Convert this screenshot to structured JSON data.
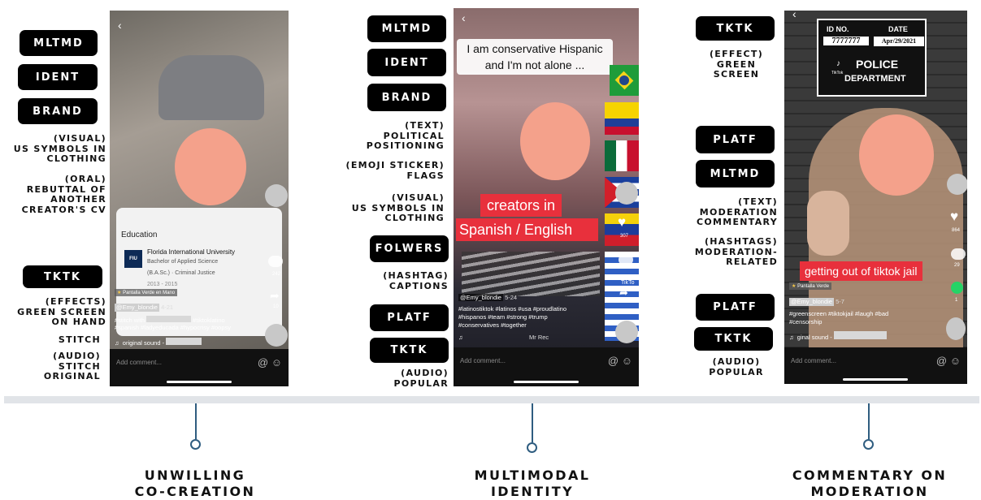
{
  "col1": {
    "pills": [
      "MLTMD",
      "IDENT",
      "BRAND",
      "TKTK"
    ],
    "notes": [
      "(VISUAL)\nUS SYMBOLS IN\nCLOTHING",
      "(ORAL)\nREBUTTAL OF\nANOTHER\nCREATOR'S CV",
      "(EFFECTS)\nGREEN SCREEN\nON HAND",
      "STITCH",
      "(AUDIO)\nSTITCH\nORIGINAL"
    ]
  },
  "col2": {
    "pills": [
      "MLTMD",
      "IDENT",
      "BRAND",
      "FOLWERS",
      "PLATF",
      "TKTK"
    ],
    "notes": [
      "(TEXT)\nPOLITICAL\nPOSITIONING",
      "(EMOJI STICKER)\nFLAGS",
      "(VISUAL)\nUS SYMBOLS IN\nCLOTHING",
      "(HASHTAG)\nCAPTIONS",
      "(AUDIO)\nPOPULAR"
    ]
  },
  "col3": {
    "pills": [
      "TKTK",
      "PLATF",
      "MLTMD",
      "PLATF",
      "TKTK"
    ],
    "notes": [
      "(EFFECT)\nGREEN\nSCREEN",
      "(TEXT)\nMODERATION\nCOMMENTARY",
      "(HASHTAGS)\nMODERATION-\nRELATED",
      "(AUDIO)\nPOPULAR"
    ]
  },
  "phone1": {
    "card_title": "Education",
    "school": "Florida International University",
    "degree": "Bachelor of Applied Science",
    "major": "(B.A.Sc.) · Criminal Justice",
    "years": "2013 - 2015",
    "logo": "FIU",
    "effect": "Pantalla Verde en Mano",
    "user": "@Emy_blondie",
    "date": "4-21",
    "stitch": "#stitch with",
    "tag1": "#tiktoklatino",
    "tags": "#spanish #ladyeducada #hypocrisy #oopsy",
    "sound": "original sound -",
    "comments": "242",
    "shares": "10",
    "add_comment": "Add comment..."
  },
  "phone2": {
    "headline1": "I am conservative Hispanic",
    "headline2": "and I'm not alone ...",
    "caption1": "creators in",
    "caption2": "Spanish / English",
    "user": "@Emy_blondie",
    "date": "5-24",
    "tags1": "#latinostiktok #latinos #usa #proudlatino",
    "tags2": "#hispanos #team #strong #trump",
    "tags3": "#conservatives #together",
    "sound": "Mr Rec",
    "likes": "307",
    "add_comment": "Add comment...",
    "tiktok": "TikTo"
  },
  "phone3": {
    "id_label": "ID NO.",
    "date_label": "DATE",
    "id_value": "7777777",
    "date_value": "Apr/29/2021",
    "police1": "POLICE",
    "police2": "DEPARTMENT",
    "tiktok": "TikTok",
    "likes": "864",
    "comments": "29",
    "shares": "1",
    "caption": "getting out of tiktok jail",
    "effect": "Pantalla Verde",
    "user": "@Emy_blondie",
    "date": "5-7",
    "tags1": "#greenscreen #tiktokjail #laugh #bad",
    "tags2": "#censorship",
    "sound": "ginal sound -",
    "add_comment": "Add comment..."
  },
  "themes": [
    "UNWILLING\nCO-CREATION",
    "MULTIMODAL\nIDENTITY",
    "COMMENTARY ON\nMODERATION"
  ]
}
